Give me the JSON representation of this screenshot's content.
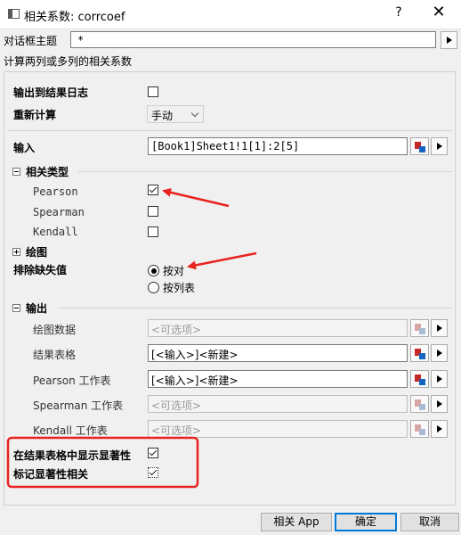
{
  "window": {
    "title": "相关系数: corrcoef",
    "help": "?",
    "close": "✕"
  },
  "dialog_theme": {
    "label": "对话框主题",
    "value": "*"
  },
  "description": "计算两列或多列的相关系数",
  "output_log": {
    "label": "输出到结果日志",
    "checked": false
  },
  "recalc": {
    "label": "重新计算",
    "value": "手动"
  },
  "input": {
    "label": "输入",
    "value": "[Book1]Sheet1!1[1]:2[5]"
  },
  "corr_type": {
    "header": "相关类型",
    "items": [
      {
        "label": "Pearson",
        "checked": true
      },
      {
        "label": "Spearman",
        "checked": false
      },
      {
        "label": "Kendall",
        "checked": false
      }
    ]
  },
  "plot": {
    "header": "绘图"
  },
  "missing": {
    "label": "排除缺失值",
    "option_pairwise": "按对",
    "option_listwise": "按列表",
    "selected": "按对"
  },
  "output": {
    "header": "输出",
    "plot_data": {
      "label": "绘图数据",
      "value": "<可选项>"
    },
    "result_table": {
      "label": "结果表格",
      "value": "[<输入>]<新建>"
    },
    "pearson_ws": {
      "label": "Pearson 工作表",
      "value": "[<输入>]<新建>"
    },
    "spearman_ws": {
      "label": "Spearman 工作表",
      "value": "<可选项>"
    },
    "kendall_ws": {
      "label": "Kendall 工作表",
      "value": "<可选项>"
    }
  },
  "show_significance": {
    "label": "在结果表格中显示显著性",
    "checked": true
  },
  "mark_significance": {
    "label": "标记显著性相关",
    "checked": true
  },
  "buttons": {
    "app": "相关 App",
    "ok": "确定",
    "cancel": "取消"
  },
  "colors": {
    "annotation_red": "#e8231f",
    "accent_blue": "#0078d7"
  },
  "icons": [
    "window-icon",
    "data-picker-icon",
    "expand-arrow-icon",
    "checkmark-icon",
    "annotation-arrow-icon"
  ]
}
